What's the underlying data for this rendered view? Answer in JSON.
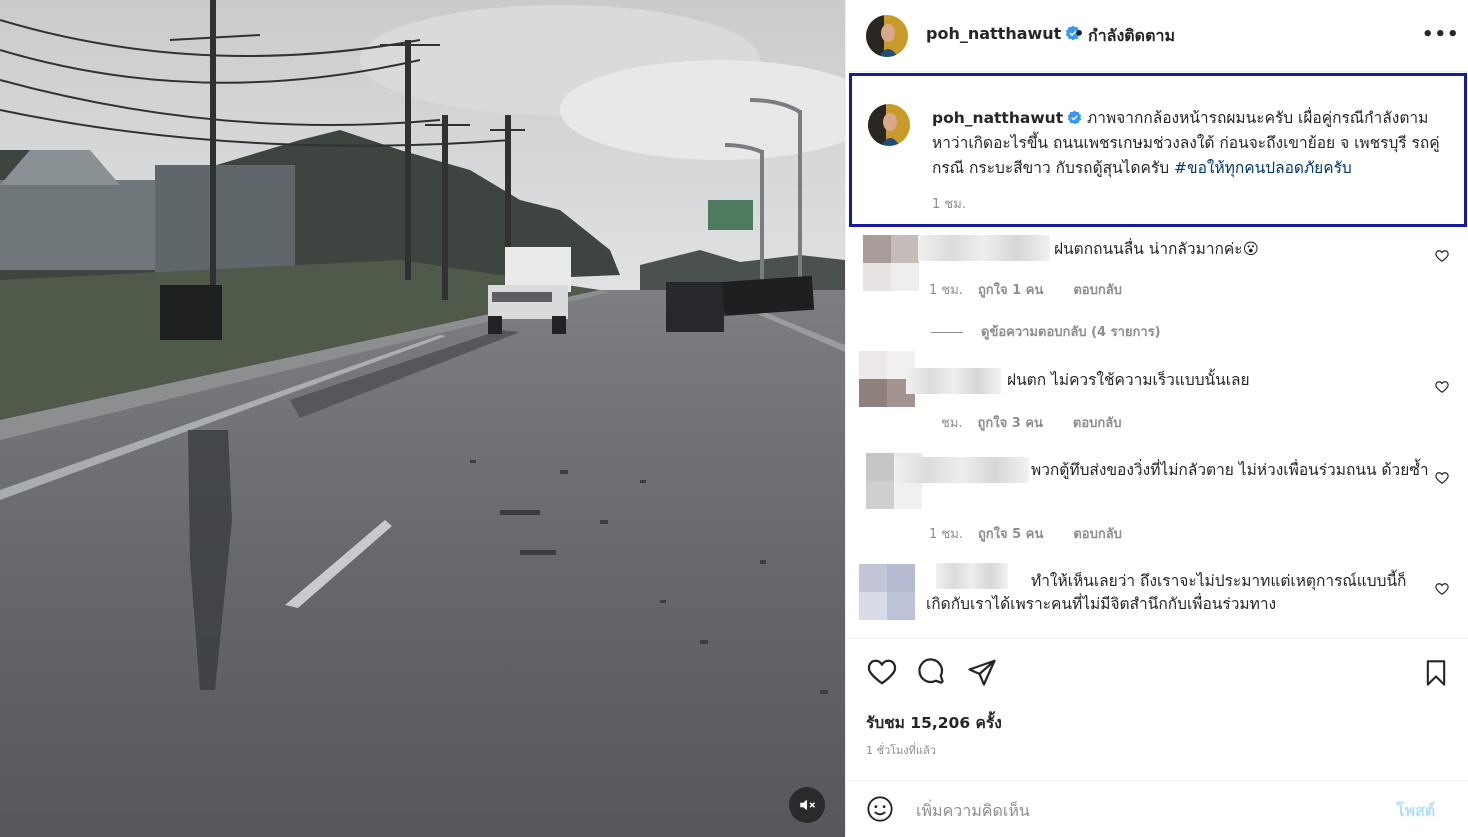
{
  "post": {
    "username": "poh_natthawut",
    "dot": "•",
    "follow_label": "กำลังติดตาม",
    "more_label": "•••"
  },
  "caption": {
    "username": "poh_natthawut",
    "text": "ภาพจากกล้องหน้ารถผมนะครับ เผื่อคู่กรณีกำลังตามหาว่าเกิดอะไรขึ้น ถนนเพชรเกษมช่วงลงใต้ ก่อนจะถึงเขาย้อย จ เพชรบุรี รถคู่กรณี กระบะสีขาว กับรถตู้สุนไดครับ ",
    "hashtag": "#ขอให้ทุกคนปลอดภัยครับ",
    "time": "1 ชม."
  },
  "comments": [
    {
      "text": "ฝนตกถนนลื่น น่ากลัวมากค่ะ😮",
      "time": "1 ชม.",
      "likes": "ถูกใจ 1 คน",
      "reply": "ตอบกลับ",
      "view_replies": "ดูข้อความตอบกลับ (4 รายการ)"
    },
    {
      "text": "ฝนตก ไม่ควรใช้ความเร็วแบบนั้นเลย",
      "time": "ชม.",
      "likes": "ถูกใจ 3 คน",
      "reply": "ตอบกลับ"
    },
    {
      "text": "พวกตู้ทึบส่งของวิ่งที่ไม่กลัวตาย ไม่ห่วงเพื่อนร่วมถนน ด้วยซ้ำ",
      "time": "1 ชม.",
      "likes": "ถูกใจ 5 คน",
      "reply": "ตอบกลับ"
    },
    {
      "text": "ทำให้เห็นเลยว่า ถึงเราจะไม่ประมาทแต่เหตุการณ์แบบนี้ก็เกิดกับเราได้เพราะคนที่ไม่มีจิตสำนึกกับเพื่อนร่วมทาง"
    }
  ],
  "stats": {
    "views": "รับชม 15,206 ครั้ง",
    "ago": "1 ชั่วโมงที่แล้ว"
  },
  "composer": {
    "placeholder": "เพิ่มความคิดเห็น",
    "post_label": "โพสต์"
  },
  "icons": {
    "mute": "speaker-muted-icon",
    "verified": "verified-badge-icon",
    "heart": "heart-icon",
    "comment": "comment-icon",
    "share": "share-icon",
    "save": "bookmark-icon",
    "emoji": "emoji-icon"
  },
  "colors": {
    "verified": "#3897f0",
    "hashtag": "#00376b",
    "highlight_border": "#1a1aa0",
    "post_button_disabled": "#b2dffc",
    "muted_text": "#8e8e8e"
  }
}
